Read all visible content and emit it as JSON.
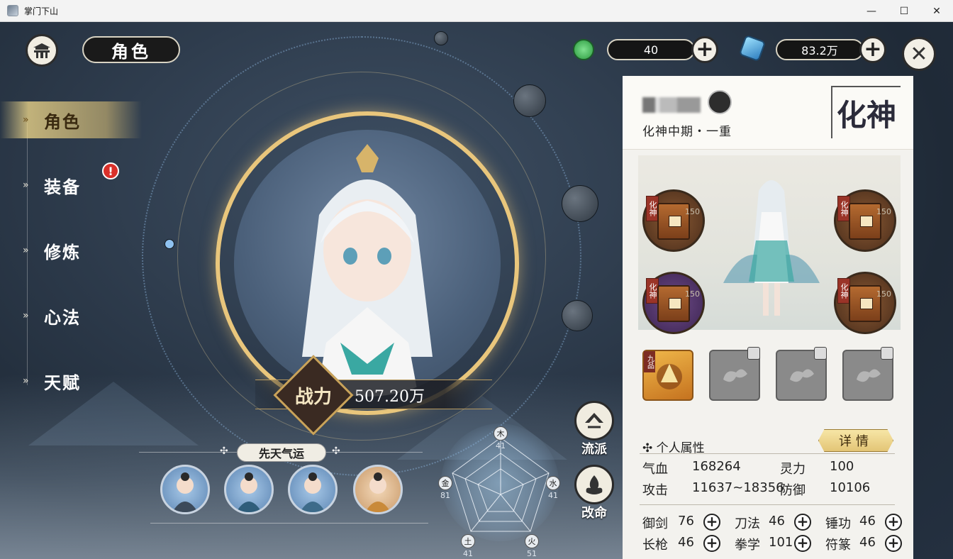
{
  "window": {
    "title": "掌门下山",
    "minimize": "—",
    "maximize": "☐",
    "close": "✕"
  },
  "header": {
    "title": "角色",
    "close_symbol": "✕"
  },
  "resources": [
    {
      "name": "jade",
      "value": "40",
      "plus": "+"
    },
    {
      "name": "spirit-stone",
      "value": "83.2万",
      "plus": "+"
    }
  ],
  "nav": {
    "items": [
      {
        "label": "角色",
        "arrow": "»",
        "active": true
      },
      {
        "label": "装备",
        "arrow": "»",
        "alert": "!"
      },
      {
        "label": "修炼",
        "arrow": "»"
      },
      {
        "label": "心法",
        "arrow": "»"
      },
      {
        "label": "天赋",
        "arrow": "»"
      }
    ]
  },
  "power": {
    "label": "战力",
    "value": "507.20万"
  },
  "fortune": {
    "title": "先天气运",
    "deco": "✣"
  },
  "radar": {
    "axes": [
      {
        "label": "木",
        "value": "41"
      },
      {
        "label": "水",
        "value": "41"
      },
      {
        "label": "火",
        "value": "51"
      },
      {
        "label": "土",
        "value": "41"
      },
      {
        "label": "金",
        "value": "81"
      }
    ]
  },
  "side_buttons": {
    "school": "流派",
    "fate": "改命"
  },
  "panel": {
    "realm_stage": "化神中期・一重",
    "realm_seal": "化神",
    "equipment": [
      {
        "tag": "化神",
        "level": "150"
      },
      {
        "tag": "化神",
        "level": "150"
      },
      {
        "tag": "化神",
        "level": "150"
      },
      {
        "tag": "化神",
        "level": "150"
      }
    ],
    "slot_tag": "九品",
    "attr_title": "个人属性",
    "detail_button": "详情",
    "attributes": [
      {
        "label": "气血",
        "value": "168264"
      },
      {
        "label": "灵力",
        "value": "100"
      },
      {
        "label": "攻击",
        "value": "11637~18356"
      },
      {
        "label": "防御",
        "value": "10106"
      }
    ],
    "skills": [
      {
        "label": "御剑",
        "value": "76"
      },
      {
        "label": "刀法",
        "value": "46"
      },
      {
        "label": "锤功",
        "value": "46"
      },
      {
        "label": "长枪",
        "value": "46"
      },
      {
        "label": "拳学",
        "value": "101"
      },
      {
        "label": "符篆",
        "value": "46"
      }
    ],
    "skill_plus": "+"
  },
  "colors": {
    "accent_gold": "#e9c67c",
    "panel_bg": "#f3f2ee",
    "alert_red": "#d9302a"
  }
}
